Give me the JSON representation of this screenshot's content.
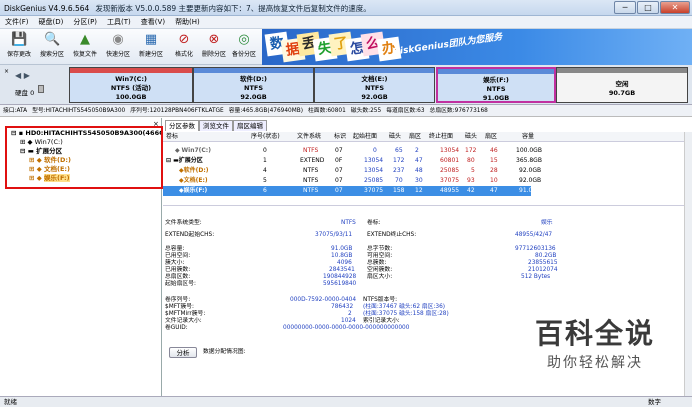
{
  "window": {
    "title": "DiskGenius V4.9.6.564",
    "notice": "发现新版本 V5.0.0.589 主要更新内容如下：7、提高恢复文件后复制文件的速度。",
    "minimize": "─",
    "maximize": "□",
    "close": "✕"
  },
  "menu": [
    "文件(F)",
    "硬盘(D)",
    "分区(P)",
    "工具(T)",
    "查看(V)",
    "帮助(H)"
  ],
  "toolbar": [
    {
      "label": "保存更改",
      "icon": "💾",
      "color": "#2a5db0"
    },
    {
      "label": "搜索分区",
      "icon": "🔍",
      "color": "#333"
    },
    {
      "label": "恢复文件",
      "icon": "▲",
      "color": "#3a8a2a"
    },
    {
      "label": "快速分区",
      "icon": "◉",
      "color": "#888"
    },
    {
      "label": "新建分区",
      "icon": "▦",
      "color": "#2a6ab0"
    },
    {
      "label": "格式化",
      "icon": "⊘",
      "color": "#c02020"
    },
    {
      "label": "删除分区",
      "icon": "⊗",
      "color": "#c02020"
    },
    {
      "label": "备份分区",
      "icon": "◎",
      "color": "#2a8a3a"
    }
  ],
  "banner": {
    "chars": [
      "数",
      "据",
      "丢",
      "失",
      "了",
      "怎",
      "么",
      "办"
    ],
    "colors": [
      "#1a5fb0",
      "#e04010",
      "#2a2a2a",
      "#20a030",
      "#e0a010",
      "#2a4aa0",
      "#c01060",
      "#e08010"
    ],
    "slogan": "DiskGenius团队为您服务"
  },
  "disk_map": {
    "disk_label": "硬盘 0",
    "partitions": [
      {
        "name": "Win7(C:)",
        "fs": "NTFS (活动)",
        "size": "100.0GB",
        "bar": "#d94c4c"
      },
      {
        "name": "软件(D:)",
        "fs": "NTFS",
        "size": "92.0GB",
        "bar": "#5a8ad8"
      },
      {
        "name": "文档(E:)",
        "fs": "NTFS",
        "size": "92.0GB",
        "bar": "#5a8ad8"
      },
      {
        "name": "娱乐(F:)",
        "fs": "NTFS",
        "size": "91.0GB",
        "bar": "#5a8ad8"
      },
      {
        "name": "空闲",
        "fs": "",
        "size": "90.7GB",
        "bar": "#888"
      }
    ]
  },
  "disk_info": [
    "接口:ATA",
    "型号:HITACHIHTS545050B9A300",
    "序列号:120128PBN406FTKLATGE",
    "容量:465.8GB(476940MB)",
    "柱面数:60801",
    "磁头数:255",
    "每道扇区数:63",
    "总扇区数:976773168"
  ],
  "tree": {
    "disk": "HD0:HITACHIHTS545050B9A300(466GB",
    "items": [
      {
        "label": "Win7(C:)",
        "color": "#666"
      },
      {
        "label": "扩展分区",
        "color": "#000"
      },
      {
        "label": "软件(D:)",
        "color": "#c07000"
      },
      {
        "label": "文档(E:)",
        "color": "#c07000"
      },
      {
        "label": "娱乐(F:)",
        "color": "#c07000"
      }
    ]
  },
  "tabs": [
    "分区参数",
    "浏览文件",
    "扇区编辑"
  ],
  "table": {
    "headers": [
      "卷标",
      "序号(状态)",
      "文件系统",
      "标识",
      "起始柱面",
      "磁头",
      "扇区",
      "终止柱面",
      "磁头",
      "扇区",
      "容量"
    ],
    "rows": [
      [
        "Win7(C:)",
        "0",
        "NTFS",
        "07",
        "0",
        "65",
        "2",
        "13054",
        "172",
        "46",
        "100.0GB"
      ],
      [
        "扩展分区",
        "1",
        "EXTEND",
        "0F",
        "13054",
        "172",
        "47",
        "60801",
        "80",
        "15",
        "365.8GB"
      ],
      [
        "软件(D:)",
        "4",
        "NTFS",
        "07",
        "13054",
        "237",
        "48",
        "25085",
        "5",
        "28",
        "92.0GB"
      ],
      [
        "文档(E:)",
        "5",
        "NTFS",
        "07",
        "25085",
        "70",
        "30",
        "37075",
        "93",
        "10",
        "92.0GB"
      ],
      [
        "娱乐(F:)",
        "6",
        "NTFS",
        "07",
        "37075",
        "158",
        "12",
        "48955",
        "42",
        "47",
        "91.0GB"
      ]
    ]
  },
  "details": {
    "fs_type_label": "文件系统类型:",
    "fs_type": "NTFS",
    "vol_label_label": "卷标:",
    "vol_label": "娱乐",
    "ext_start_label": "EXTEND起始CHS:",
    "ext_start": "37075/93/11",
    "ext_end_label": "EXTEND终止CHS:",
    "ext_end": "48955/42/47",
    "left": [
      [
        "总容量:",
        "91.0GB"
      ],
      [
        "已用空间:",
        "10.8GB"
      ],
      [
        "簇大小:",
        "4096"
      ],
      [
        "已用簇数:",
        "2843541"
      ],
      [
        "总扇区数:",
        "190844928"
      ],
      [
        "起始扇区号:",
        "595619840"
      ]
    ],
    "right": [
      [
        "总字节数:",
        "97712603136"
      ],
      [
        "可用空间:",
        "80.2GB"
      ],
      [
        "总簇数:",
        "23855615"
      ],
      [
        "空闲簇数:",
        "21012074"
      ],
      [
        "扇区大小:",
        "512 Bytes"
      ]
    ],
    "serial_label": "卷序列号:",
    "serial": "000D-7592-0000-0404",
    "ntfs_ver_label": "NTFS版本号:",
    "mft_label": "$MFT簇号:",
    "mft": "786432",
    "mft_chs": "(柱面:37467 磁头:62 扇区:36)",
    "mftmirr_label": "$MFTMirr簇号:",
    "mftmirr": "2",
    "mftmirr_chs": "(柱面:37075 磁头:158 扇区:28)",
    "frs_label": "文件记录大小:",
    "frs": "1024",
    "idx_label": "索引记录大小:",
    "guid_label": "卷GUID:",
    "guid": "00000000-0000-0000-0000-000000000000"
  },
  "analyze_button": "分析",
  "alloc_label": "数据分配情况图:",
  "status": {
    "left": "就绪",
    "right": "数字"
  },
  "watermark": {
    "big": "百科全说",
    "small": "助你轻松解决"
  }
}
